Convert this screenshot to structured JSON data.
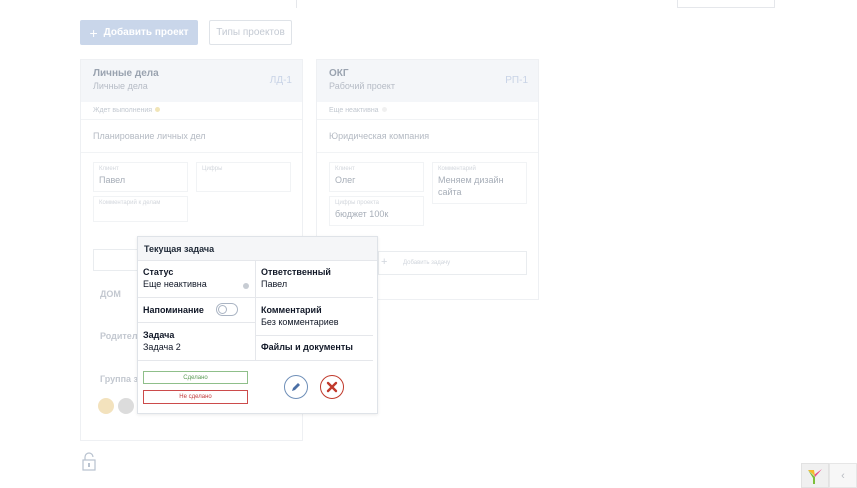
{
  "toolbar": {
    "add_project_label": "Добавить проект",
    "project_types_label": "Типы проектов"
  },
  "cards": [
    {
      "title": "Личные дела",
      "subtitle": "Личные дела",
      "code": "ЛД-1",
      "status": "Ждет выполнения",
      "description": "Планирование личных дел",
      "fields": [
        {
          "label": "Клиент",
          "value": "Павел"
        },
        {
          "label": "Цифры",
          "value": ""
        },
        {
          "label": "Комментарий к делам",
          "value": ""
        }
      ],
      "sections": [
        "ДОМ",
        "Родител",
        "Группа з"
      ]
    },
    {
      "title": "ОКГ",
      "subtitle": "Рабочий проект",
      "code": "РП-1",
      "status": "Еще неактивна",
      "description": "Юридическая компания",
      "fields": [
        {
          "label": "Клиент",
          "value": "Олег"
        },
        {
          "label": "Комментарий",
          "value": "Меняем дизайн сайта"
        },
        {
          "label": "Цифры проекта",
          "value": "бюджет 100к"
        }
      ],
      "add_task_placeholder": "Добавить задачу"
    }
  ],
  "popup": {
    "title": "Текущая задача",
    "status_label": "Статус",
    "status_value": "Еще неактивна",
    "responsible_label": "Ответственный",
    "responsible_value": "Павел",
    "reminder_label": "Напоминание",
    "reminder_on": false,
    "comment_label": "Комментарий",
    "comment_value": "Без комментариев",
    "task_label": "Задача",
    "task_value": "Задача 2",
    "files_label": "Файлы и документы",
    "done_label": "Сделано",
    "not_done_label": "Не сделано"
  },
  "colors": {
    "accent": "#c9d6ea",
    "done": "#5a9a55",
    "not_done": "#c23b3b",
    "edit": "#4a6fa5"
  },
  "icons": [
    "plus-icon",
    "pencil-icon",
    "close-icon",
    "lock-icon",
    "yii-logo-icon",
    "chevron-left-icon"
  ]
}
